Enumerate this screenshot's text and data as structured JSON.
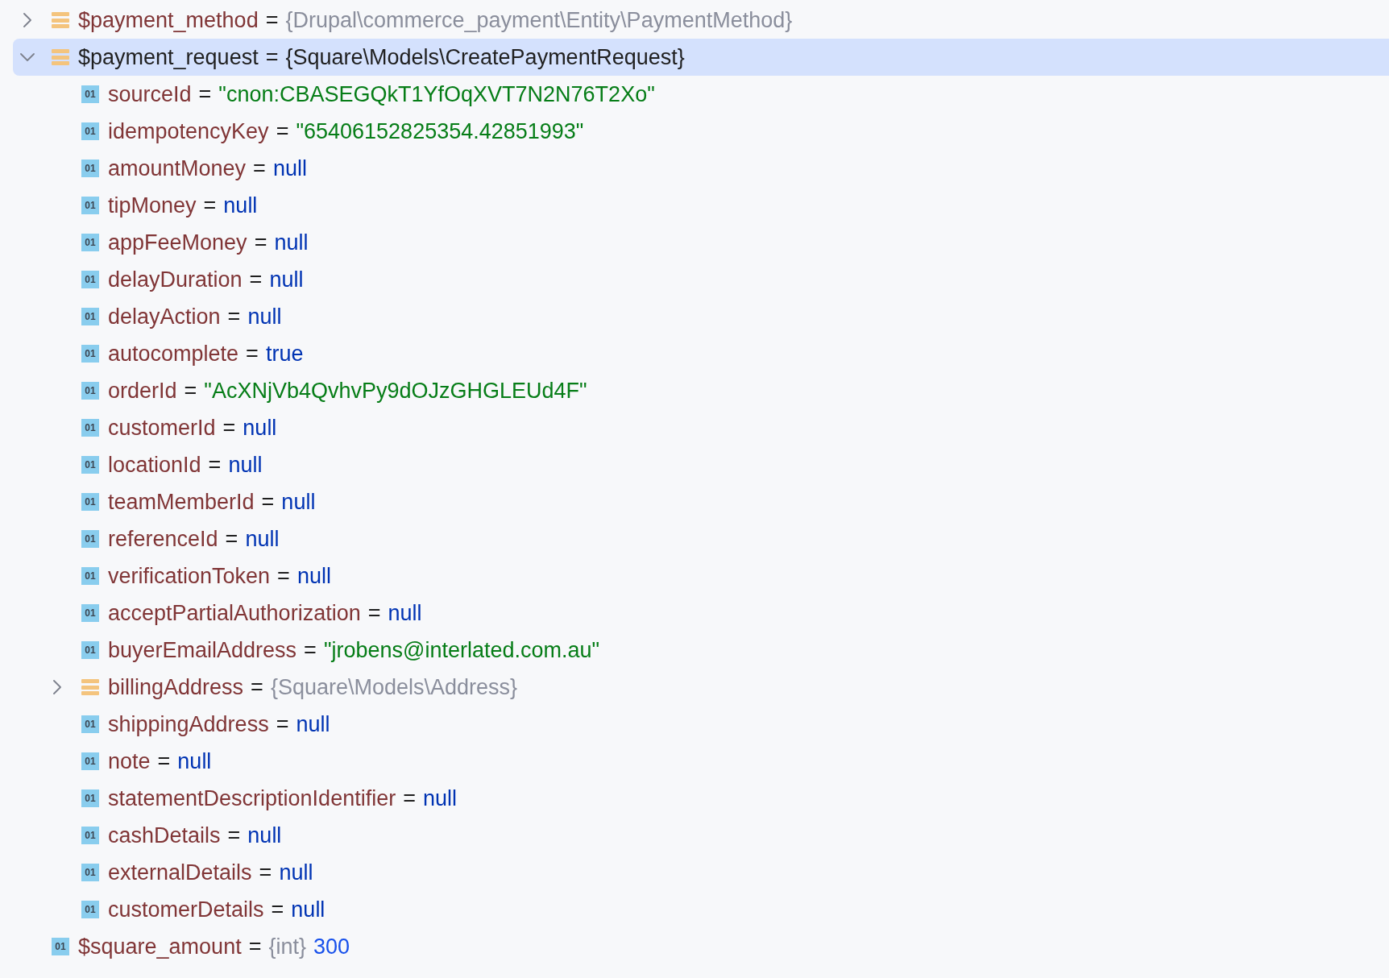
{
  "variables": [
    {
      "name": "$payment_method",
      "separator": "=",
      "type": "{Drupal\\commerce_payment\\Entity\\PaymentMethod}",
      "kind": "object",
      "expanded": false,
      "selected": false
    },
    {
      "name": "$payment_request",
      "separator": "=",
      "type": "{Square\\Models\\CreatePaymentRequest}",
      "kind": "object",
      "expanded": true,
      "selected": true,
      "children": [
        {
          "name": "sourceId",
          "separator": "=",
          "kind": "primitive",
          "icon_label": "01",
          "value": {
            "text": "\"cnon:CBASEGQkT1YfOqXVT7N2N76T2Xo\"",
            "kind": "string"
          },
          "selected": false
        },
        {
          "name": "idempotencyKey",
          "separator": "=",
          "kind": "primitive",
          "icon_label": "01",
          "value": {
            "text": "\"65406152825354.42851993\"",
            "kind": "string"
          },
          "selected": false
        },
        {
          "name": "amountMoney",
          "separator": "=",
          "kind": "primitive",
          "icon_label": "01",
          "value": {
            "text": "null",
            "kind": "keyword"
          },
          "selected": false
        },
        {
          "name": "tipMoney",
          "separator": "=",
          "kind": "primitive",
          "icon_label": "01",
          "value": {
            "text": "null",
            "kind": "keyword"
          },
          "selected": false
        },
        {
          "name": "appFeeMoney",
          "separator": "=",
          "kind": "primitive",
          "icon_label": "01",
          "value": {
            "text": "null",
            "kind": "keyword"
          },
          "selected": false
        },
        {
          "name": "delayDuration",
          "separator": "=",
          "kind": "primitive",
          "icon_label": "01",
          "value": {
            "text": "null",
            "kind": "keyword"
          },
          "selected": false
        },
        {
          "name": "delayAction",
          "separator": "=",
          "kind": "primitive",
          "icon_label": "01",
          "value": {
            "text": "null",
            "kind": "keyword"
          },
          "selected": false
        },
        {
          "name": "autocomplete",
          "separator": "=",
          "kind": "primitive",
          "icon_label": "01",
          "value": {
            "text": "true",
            "kind": "keyword"
          },
          "selected": false
        },
        {
          "name": "orderId",
          "separator": "=",
          "kind": "primitive",
          "icon_label": "01",
          "value": {
            "text": "\"AcXNjVb4QvhvPy9dOJzGHGLEUd4F\"",
            "kind": "string"
          },
          "selected": false
        },
        {
          "name": "customerId",
          "separator": "=",
          "kind": "primitive",
          "icon_label": "01",
          "value": {
            "text": "null",
            "kind": "keyword"
          },
          "selected": false
        },
        {
          "name": "locationId",
          "separator": "=",
          "kind": "primitive",
          "icon_label": "01",
          "value": {
            "text": "null",
            "kind": "keyword"
          },
          "selected": false
        },
        {
          "name": "teamMemberId",
          "separator": "=",
          "kind": "primitive",
          "icon_label": "01",
          "value": {
            "text": "null",
            "kind": "keyword"
          },
          "selected": false
        },
        {
          "name": "referenceId",
          "separator": "=",
          "kind": "primitive",
          "icon_label": "01",
          "value": {
            "text": "null",
            "kind": "keyword"
          },
          "selected": false
        },
        {
          "name": "verificationToken",
          "separator": "=",
          "kind": "primitive",
          "icon_label": "01",
          "value": {
            "text": "null",
            "kind": "keyword"
          },
          "selected": false
        },
        {
          "name": "acceptPartialAuthorization",
          "separator": "=",
          "kind": "primitive",
          "icon_label": "01",
          "value": {
            "text": "null",
            "kind": "keyword"
          },
          "selected": false
        },
        {
          "name": "buyerEmailAddress",
          "separator": "=",
          "kind": "primitive",
          "icon_label": "01",
          "value": {
            "text": "\"jrobens@interlated.com.au\"",
            "kind": "string"
          },
          "selected": false
        },
        {
          "name": "billingAddress",
          "separator": "=",
          "type": "{Square\\Models\\Address}",
          "kind": "object",
          "expanded": false,
          "selected": false
        },
        {
          "name": "shippingAddress",
          "separator": "=",
          "kind": "primitive",
          "icon_label": "01",
          "value": {
            "text": "null",
            "kind": "keyword"
          },
          "selected": false
        },
        {
          "name": "note",
          "separator": "=",
          "kind": "primitive",
          "icon_label": "01",
          "value": {
            "text": "null",
            "kind": "keyword"
          },
          "selected": false
        },
        {
          "name": "statementDescriptionIdentifier",
          "separator": "=",
          "kind": "primitive",
          "icon_label": "01",
          "value": {
            "text": "null",
            "kind": "keyword"
          },
          "selected": false
        },
        {
          "name": "cashDetails",
          "separator": "=",
          "kind": "primitive",
          "icon_label": "01",
          "value": {
            "text": "null",
            "kind": "keyword"
          },
          "selected": false
        },
        {
          "name": "externalDetails",
          "separator": "=",
          "kind": "primitive",
          "icon_label": "01",
          "value": {
            "text": "null",
            "kind": "keyword"
          },
          "selected": false
        },
        {
          "name": "customerDetails",
          "separator": "=",
          "kind": "primitive",
          "icon_label": "01",
          "value": {
            "text": "null",
            "kind": "keyword"
          },
          "selected": false
        }
      ]
    },
    {
      "name": "$square_amount",
      "separator": "=",
      "type": "{int}",
      "kind": "primitive",
      "icon_label": "01",
      "value": {
        "text": "300",
        "kind": "number"
      },
      "selected": false
    }
  ]
}
